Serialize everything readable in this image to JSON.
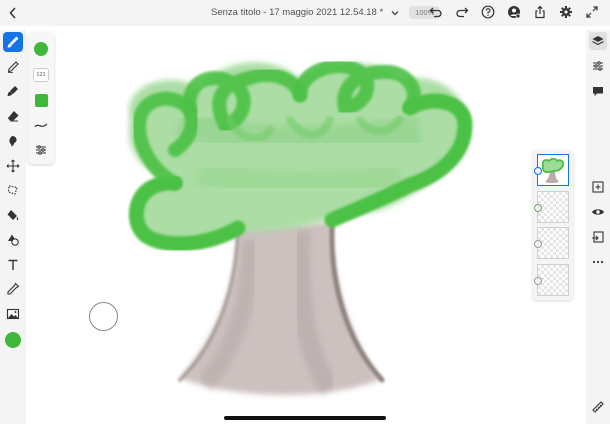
{
  "document": {
    "title": "Senza titolo - 17 maggio 2021 12.54.18 *",
    "zoom": "100%"
  },
  "brush": {
    "size": "121",
    "color": "#3fb83a"
  },
  "colors": {
    "accent": "#1473e6",
    "brush_green": "#3fb83a",
    "trunk": "#b8adab"
  },
  "icons": {
    "top": [
      "back-icon",
      "undo-icon",
      "redo-icon",
      "help-icon",
      "account-icon",
      "share-icon",
      "settings-icon",
      "fullscreen-icon"
    ],
    "left": [
      "paint-brush-icon",
      "pencil-icon",
      "blend-brush-icon",
      "eraser-icon",
      "smudge-icon",
      "transform-icon",
      "lasso-icon",
      "fill-icon",
      "shape-icon",
      "text-icon",
      "eyedropper-icon",
      "image-icon"
    ],
    "right": [
      "layers-icon",
      "properties-icon",
      "comments-icon",
      "add-layer-icon",
      "visibility-icon",
      "merge-icon",
      "more-icon",
      "ruler-icon"
    ]
  },
  "layers": {
    "count": 4,
    "active_index": 0
  }
}
